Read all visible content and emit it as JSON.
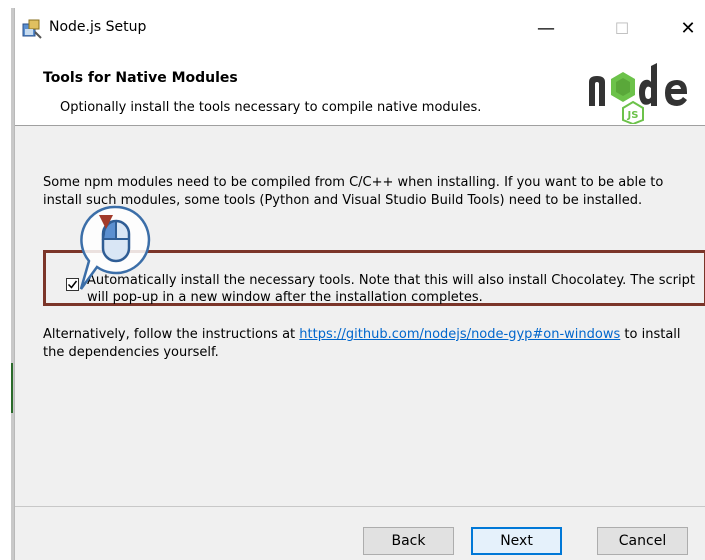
{
  "window": {
    "title": "Node.js Setup",
    "minimize": "—",
    "maximize": "☐",
    "close": "✕"
  },
  "header": {
    "title": "Tools for Native Modules",
    "subtitle": "Optionally install the tools necessary to compile native modules.",
    "logo_text": "node",
    "logo_badge": "JS"
  },
  "content": {
    "paragraph1": "Some npm modules need to be compiled from C/C++ when installing. If you want to be able to install such modules, some tools (Python and Visual Studio Build Tools) need to be installed.",
    "checkbox_label": "Automatically install the necessary tools. Note that this will also install Chocolatey. The script will pop-up in a new window after the installation completes.",
    "checkbox_checked": true,
    "paragraph2_prefix": "Alternatively, follow the instructions at ",
    "link": "https://github.com/nodejs/node-gyp#on-windows",
    "paragraph2_suffix": " to install the dependencies yourself."
  },
  "buttons": {
    "back": "Back",
    "next": "Next",
    "cancel": "Cancel"
  },
  "colors": {
    "highlight": "#7b3529",
    "node_green": "#6cc24a",
    "node_dark": "#333333",
    "link": "#0066cc",
    "focus": "#0078d7"
  }
}
